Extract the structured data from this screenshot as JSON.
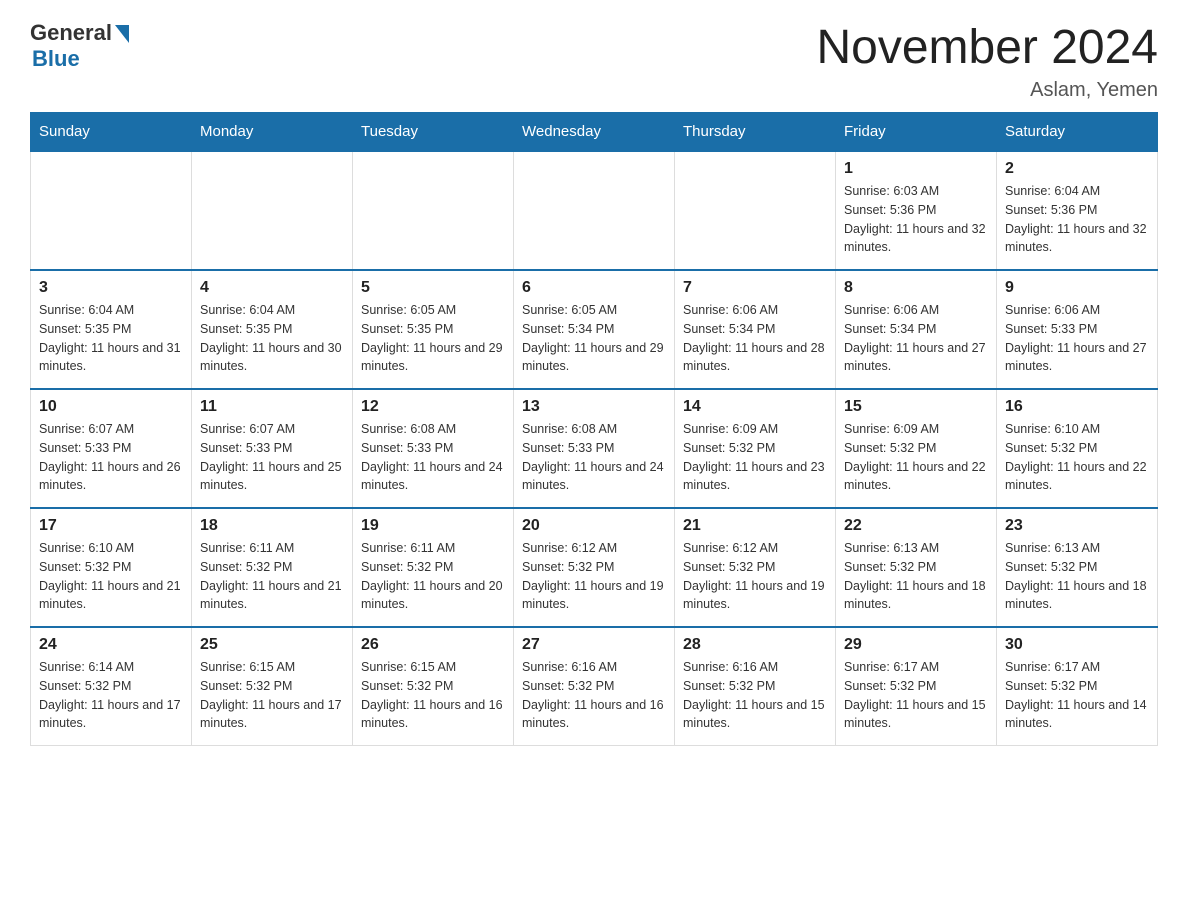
{
  "header": {
    "logo_general": "General",
    "logo_blue": "Blue",
    "month_title": "November 2024",
    "location": "Aslam, Yemen"
  },
  "weekdays": [
    "Sunday",
    "Monday",
    "Tuesday",
    "Wednesday",
    "Thursday",
    "Friday",
    "Saturday"
  ],
  "weeks": [
    [
      {
        "day": "",
        "info": ""
      },
      {
        "day": "",
        "info": ""
      },
      {
        "day": "",
        "info": ""
      },
      {
        "day": "",
        "info": ""
      },
      {
        "day": "",
        "info": ""
      },
      {
        "day": "1",
        "info": "Sunrise: 6:03 AM\nSunset: 5:36 PM\nDaylight: 11 hours and 32 minutes."
      },
      {
        "day": "2",
        "info": "Sunrise: 6:04 AM\nSunset: 5:36 PM\nDaylight: 11 hours and 32 minutes."
      }
    ],
    [
      {
        "day": "3",
        "info": "Sunrise: 6:04 AM\nSunset: 5:35 PM\nDaylight: 11 hours and 31 minutes."
      },
      {
        "day": "4",
        "info": "Sunrise: 6:04 AM\nSunset: 5:35 PM\nDaylight: 11 hours and 30 minutes."
      },
      {
        "day": "5",
        "info": "Sunrise: 6:05 AM\nSunset: 5:35 PM\nDaylight: 11 hours and 29 minutes."
      },
      {
        "day": "6",
        "info": "Sunrise: 6:05 AM\nSunset: 5:34 PM\nDaylight: 11 hours and 29 minutes."
      },
      {
        "day": "7",
        "info": "Sunrise: 6:06 AM\nSunset: 5:34 PM\nDaylight: 11 hours and 28 minutes."
      },
      {
        "day": "8",
        "info": "Sunrise: 6:06 AM\nSunset: 5:34 PM\nDaylight: 11 hours and 27 minutes."
      },
      {
        "day": "9",
        "info": "Sunrise: 6:06 AM\nSunset: 5:33 PM\nDaylight: 11 hours and 27 minutes."
      }
    ],
    [
      {
        "day": "10",
        "info": "Sunrise: 6:07 AM\nSunset: 5:33 PM\nDaylight: 11 hours and 26 minutes."
      },
      {
        "day": "11",
        "info": "Sunrise: 6:07 AM\nSunset: 5:33 PM\nDaylight: 11 hours and 25 minutes."
      },
      {
        "day": "12",
        "info": "Sunrise: 6:08 AM\nSunset: 5:33 PM\nDaylight: 11 hours and 24 minutes."
      },
      {
        "day": "13",
        "info": "Sunrise: 6:08 AM\nSunset: 5:33 PM\nDaylight: 11 hours and 24 minutes."
      },
      {
        "day": "14",
        "info": "Sunrise: 6:09 AM\nSunset: 5:32 PM\nDaylight: 11 hours and 23 minutes."
      },
      {
        "day": "15",
        "info": "Sunrise: 6:09 AM\nSunset: 5:32 PM\nDaylight: 11 hours and 22 minutes."
      },
      {
        "day": "16",
        "info": "Sunrise: 6:10 AM\nSunset: 5:32 PM\nDaylight: 11 hours and 22 minutes."
      }
    ],
    [
      {
        "day": "17",
        "info": "Sunrise: 6:10 AM\nSunset: 5:32 PM\nDaylight: 11 hours and 21 minutes."
      },
      {
        "day": "18",
        "info": "Sunrise: 6:11 AM\nSunset: 5:32 PM\nDaylight: 11 hours and 21 minutes."
      },
      {
        "day": "19",
        "info": "Sunrise: 6:11 AM\nSunset: 5:32 PM\nDaylight: 11 hours and 20 minutes."
      },
      {
        "day": "20",
        "info": "Sunrise: 6:12 AM\nSunset: 5:32 PM\nDaylight: 11 hours and 19 minutes."
      },
      {
        "day": "21",
        "info": "Sunrise: 6:12 AM\nSunset: 5:32 PM\nDaylight: 11 hours and 19 minutes."
      },
      {
        "day": "22",
        "info": "Sunrise: 6:13 AM\nSunset: 5:32 PM\nDaylight: 11 hours and 18 minutes."
      },
      {
        "day": "23",
        "info": "Sunrise: 6:13 AM\nSunset: 5:32 PM\nDaylight: 11 hours and 18 minutes."
      }
    ],
    [
      {
        "day": "24",
        "info": "Sunrise: 6:14 AM\nSunset: 5:32 PM\nDaylight: 11 hours and 17 minutes."
      },
      {
        "day": "25",
        "info": "Sunrise: 6:15 AM\nSunset: 5:32 PM\nDaylight: 11 hours and 17 minutes."
      },
      {
        "day": "26",
        "info": "Sunrise: 6:15 AM\nSunset: 5:32 PM\nDaylight: 11 hours and 16 minutes."
      },
      {
        "day": "27",
        "info": "Sunrise: 6:16 AM\nSunset: 5:32 PM\nDaylight: 11 hours and 16 minutes."
      },
      {
        "day": "28",
        "info": "Sunrise: 6:16 AM\nSunset: 5:32 PM\nDaylight: 11 hours and 15 minutes."
      },
      {
        "day": "29",
        "info": "Sunrise: 6:17 AM\nSunset: 5:32 PM\nDaylight: 11 hours and 15 minutes."
      },
      {
        "day": "30",
        "info": "Sunrise: 6:17 AM\nSunset: 5:32 PM\nDaylight: 11 hours and 14 minutes."
      }
    ]
  ]
}
